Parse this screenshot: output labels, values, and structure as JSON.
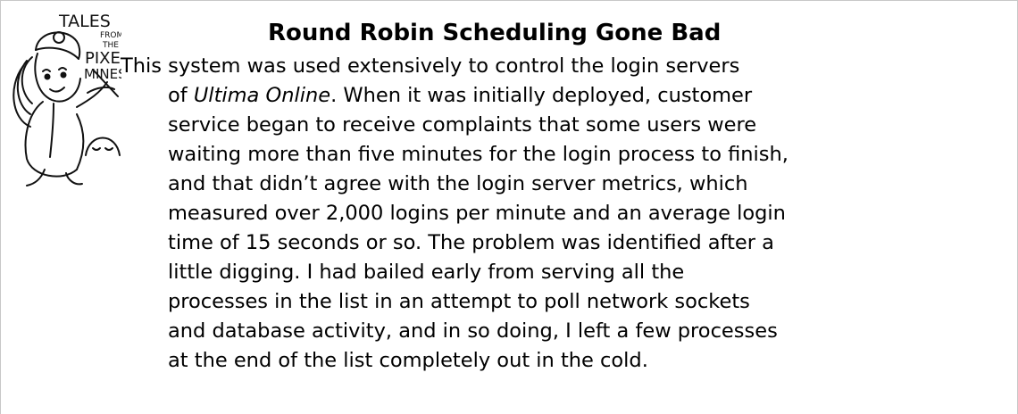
{
  "logo": {
    "words": [
      "TALES",
      "FROM",
      "THE",
      "PIXEL",
      "MINES"
    ]
  },
  "sidebar": {
    "title": "Round Robin Scheduling Gone Bad",
    "lines": [
      "This system was used extensively to control the login servers",
      "of ",
      "Ultima Online",
      ". When it was initially deployed, customer",
      "service began to receive complaints that some users were",
      "waiting more than five minutes for the login process to finish,",
      "and that didn’t agree with the login server metrics, which",
      "measured over 2,000 logins per minute and an average login",
      "time of 15 seconds or so. The problem was identified after a",
      "little digging. I had bailed early from serving all the",
      "processes in the list in an attempt to poll network sockets",
      "and database activity, and in so doing, I left a few processes",
      "at the end of the list completely out in the cold."
    ]
  }
}
